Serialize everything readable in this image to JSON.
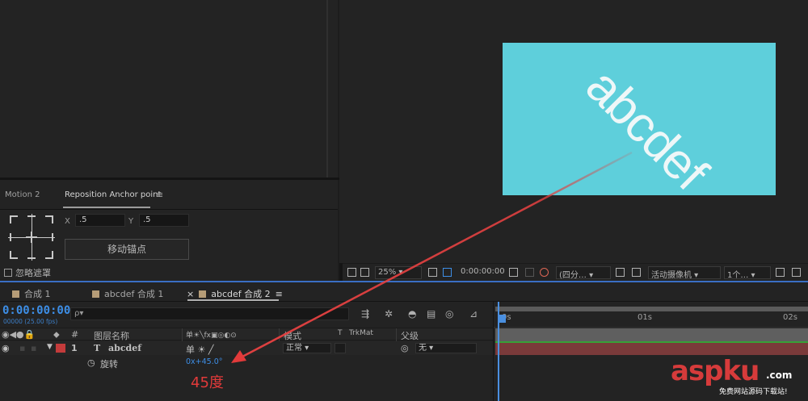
{
  "motion_panel": {
    "tab_motion2": "Motion 2",
    "tab_reposition": "Reposition Anchor point",
    "menu_icon": "≡",
    "x_label": "X",
    "x_value": ".5",
    "y_label": "Y",
    "y_value": ".5",
    "move_anchor_label": "移动锚点",
    "ignore_mask_label": "忽略遮罩"
  },
  "viewer": {
    "comp_text": "abcdef",
    "zoom": "25%",
    "timecode": "0:00:00:00",
    "resolution": "(四分…",
    "camera": "活动摄像机",
    "views": "1个…",
    "comp_bg": "#5ecfdb"
  },
  "timeline": {
    "tabs": [
      {
        "label": "合成 1",
        "close": ""
      },
      {
        "label": "abcdef 合成 1",
        "close": ""
      },
      {
        "label": "abcdef 合成 2",
        "close": "×"
      }
    ],
    "tab_menu_icon": "≡",
    "timecode": "0:00:00:00",
    "frame_info": "00000 (25.00 fps)",
    "search_placeholder": "ρ▾",
    "columns": {
      "hash": "#",
      "layer_name": "图层名称",
      "switches": "单☀╲fx▣◎◐⊙",
      "mode": "模式",
      "t": "T",
      "trkmat": "TrkMat",
      "parent": "父级"
    },
    "layer": {
      "number": "1",
      "type_icon": "T",
      "name": "abcdef",
      "switches": "单 ☀ ╱",
      "mode": "正常",
      "parent_icon": "◎",
      "parent": "无",
      "color": "#c43b3b"
    },
    "property": {
      "name": "旋转",
      "value": "0x+45.0°"
    },
    "ruler": [
      "0s",
      "01s",
      "02s"
    ]
  },
  "annotation": {
    "label": "45度",
    "color": "#e23a3a"
  },
  "watermark": {
    "logo": "aspku",
    "com": ".com",
    "sub": "免费网站源码下载站!"
  }
}
